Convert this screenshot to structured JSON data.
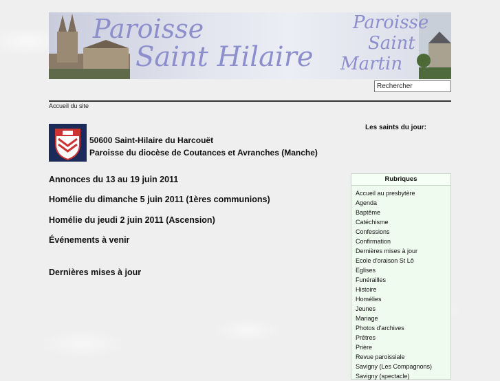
{
  "banner": {
    "title_line1": "Paroisse",
    "title_line2": "Saint Hilaire",
    "right_line1": "Paroisse",
    "right_line2": "Saint",
    "right_line3": "Martin"
  },
  "search": {
    "value": "Rechercher"
  },
  "breadcrumb": "Accueil du site",
  "header": {
    "address_line1": "50600 Saint-Hilaire du Harcouët",
    "address_line2": "Paroisse du diocèse de Coutances et Avranches (Manche)"
  },
  "main_links": [
    "Annonces du 13 au 19 juin 2011",
    "Homélie du dimanche 5 juin 2011 (1ères communions)",
    "Homélie du jeudi 2 juin 2011 (Ascension)",
    "Événements à venir",
    "Dernières mises à jour"
  ],
  "saints_label": "Les saints du jour:",
  "rubriques": {
    "title": "Rubriques",
    "items": [
      "Accueil au presbytère",
      "Agenda",
      "Baptême",
      "Catéchisme",
      "Confessions",
      "Confirmation",
      "Dernières mises à jour",
      "Ecole d'oraison St Lô",
      "Eglises",
      "Funérailles",
      "Histoire",
      "Homélies",
      "Jeunes",
      "Mariage",
      "Photos d'archives",
      "Prêtres",
      "Prière",
      "Revue paroissiale",
      "Savigny (Les Compagnons)",
      "Savigny (spectacle)"
    ]
  },
  "colors": {
    "title_text": "#8c8fcb",
    "rubriques_bg": "#f0fbef"
  }
}
